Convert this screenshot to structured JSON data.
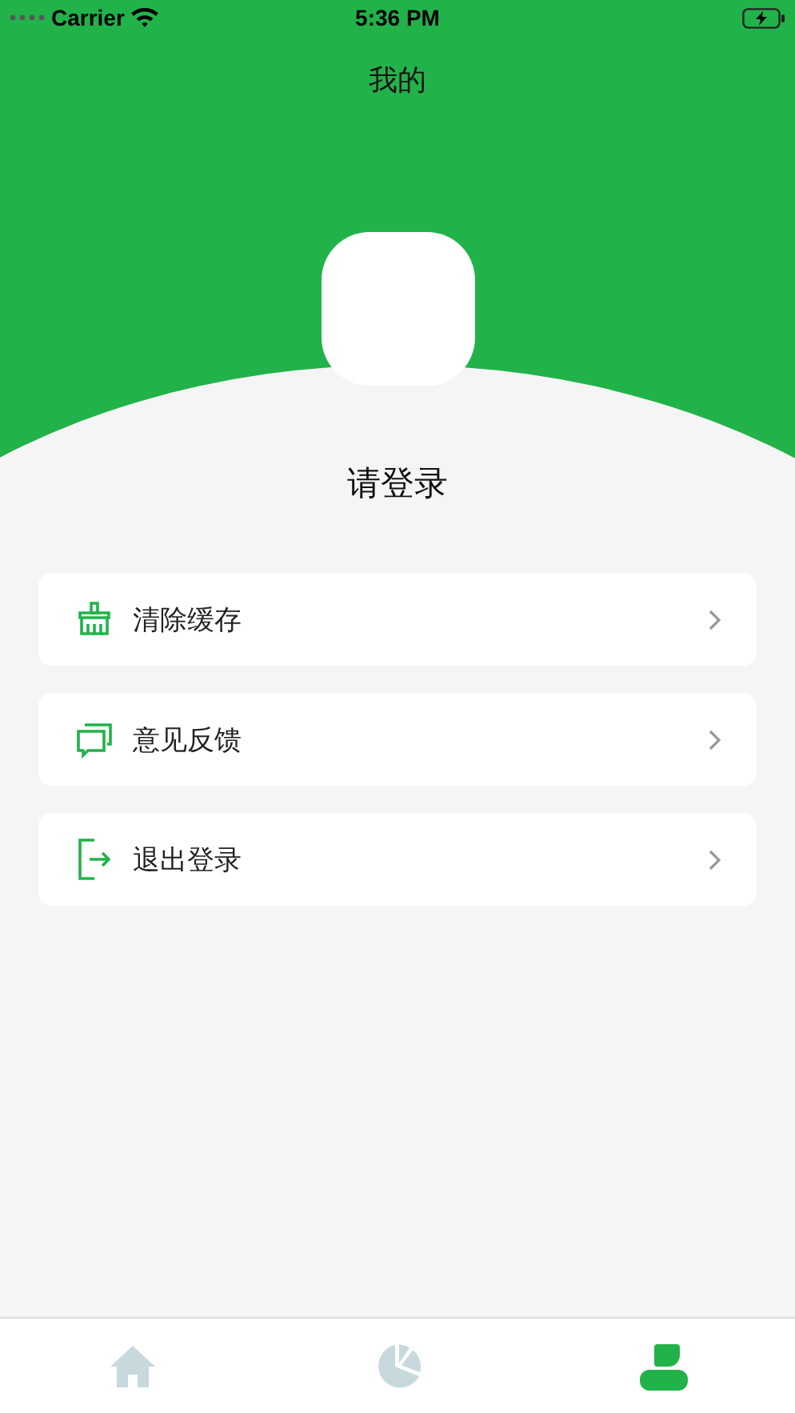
{
  "status_bar": {
    "carrier": "Carrier",
    "time": "5:36 PM"
  },
  "title": "我的",
  "login_prompt": "请登录",
  "menu": [
    {
      "kind": "clear-cache",
      "label": "清除缓存"
    },
    {
      "kind": "feedback",
      "label": "意见反馈"
    },
    {
      "kind": "logout",
      "label": "退出登录"
    }
  ],
  "tabs": [
    {
      "kind": "home",
      "selected": false
    },
    {
      "kind": "stats",
      "selected": false
    },
    {
      "kind": "profile",
      "selected": true
    }
  ]
}
